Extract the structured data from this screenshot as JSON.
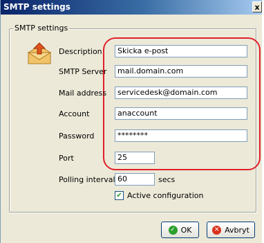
{
  "window": {
    "title": "SMTP settings",
    "close_glyph": "x"
  },
  "group": {
    "label": "SMTP settings"
  },
  "icon": "mail-icon",
  "fields": {
    "description": {
      "label": "Description",
      "value": "Skicka e-post"
    },
    "smtp_server": {
      "label": "SMTP Server",
      "value": "mail.domain.com"
    },
    "mail_address": {
      "label": "Mail address",
      "value": "servicedesk@domain.com"
    },
    "account": {
      "label": "Account",
      "value": "anaccount"
    },
    "password": {
      "label": "Password",
      "value": "********"
    },
    "port": {
      "label": "Port",
      "value": "25"
    },
    "polling_interval": {
      "label": "Polling interval",
      "value": "60",
      "unit": "secs"
    }
  },
  "active": {
    "label": "Active configuration",
    "checked": true
  },
  "buttons": {
    "ok": "OK",
    "cancel": "Avbryt"
  },
  "colors": {
    "highlight": "#e0202a",
    "ok_icon": "#2ca02c",
    "cancel_icon": "#d9321f"
  }
}
